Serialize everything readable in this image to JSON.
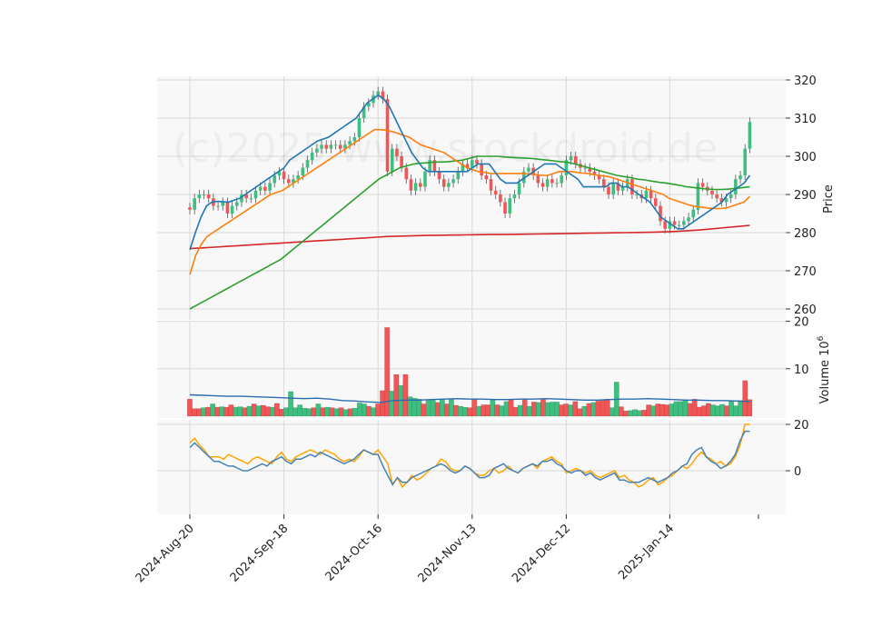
{
  "watermark": "(c)2025 www.stockdroid.de",
  "colors": {
    "up": "#3fbf7f",
    "down": "#f25555",
    "panel_bg": "#f8f8f8",
    "grid": "#d9d9d9",
    "ma_short": "#1f77b4",
    "ma_mid": "#ff7f0e",
    "ma_long": "#2ca02c",
    "ma_200": "#d62728",
    "vol_ma": "#2b6cb0",
    "osc_a": "#ffa500",
    "osc_b": "#4682b4"
  },
  "chart_data": [
    {
      "type": "candlestick",
      "panel": "price",
      "ylabel": "Price",
      "ylim": [
        257,
        320
      ],
      "yticks": [
        260,
        270,
        280,
        290,
        300,
        310,
        320
      ],
      "x_tick_labels": [
        "2024-Aug-20",
        "2024-Sep-18",
        "2024-Oct-16",
        "2024-Nov-13",
        "2024-Dec-12",
        "2025-Jan-14"
      ],
      "x_tick_index": [
        0,
        20,
        40,
        60,
        80,
        102
      ],
      "close": [
        286,
        289,
        290,
        290,
        289,
        287,
        287,
        288,
        285,
        287,
        288,
        290,
        289,
        289,
        291,
        292,
        291,
        293,
        295,
        296,
        294,
        293,
        294,
        295,
        297,
        299,
        301,
        302,
        303,
        302,
        303,
        303,
        302,
        303,
        304,
        305,
        310,
        313,
        314,
        316,
        317,
        315,
        296,
        302,
        300,
        297,
        294,
        291,
        293,
        292,
        296,
        299,
        296,
        294,
        292,
        293,
        294,
        296,
        298,
        297,
        299,
        298,
        295,
        294,
        291,
        290,
        288,
        285,
        289,
        290,
        293,
        296,
        297,
        295,
        293,
        292,
        294,
        293,
        293,
        295,
        299,
        300,
        298,
        297,
        297,
        296,
        295,
        294,
        292,
        290,
        293,
        291,
        292,
        294,
        290,
        290,
        289,
        291,
        289,
        287,
        283,
        281,
        283,
        282,
        282,
        283,
        284,
        286,
        293,
        292,
        291,
        290,
        289,
        288,
        289,
        290,
        294,
        295,
        302,
        309
      ],
      "ma_short_20": [
        275.5,
        280,
        284,
        287,
        288,
        288.2,
        288.1,
        288,
        288.5,
        289,
        290,
        291,
        292,
        293,
        294,
        295,
        296,
        297,
        299,
        300,
        301,
        302,
        303,
        304,
        304.5,
        305,
        306,
        307,
        308,
        309,
        310,
        312,
        314,
        315,
        316,
        315,
        313,
        310,
        307,
        304,
        301,
        299,
        297,
        296,
        296,
        296,
        296,
        296,
        296,
        296,
        296,
        297,
        298,
        298,
        298,
        296,
        294,
        293,
        293,
        293,
        294,
        295,
        296,
        297,
        298,
        298,
        298,
        297,
        296,
        295,
        294,
        292,
        292,
        292,
        292,
        292,
        293,
        293,
        292,
        292,
        291,
        290,
        289,
        288,
        286,
        284,
        283,
        282,
        281,
        281,
        282,
        283,
        284,
        285,
        286,
        287,
        288,
        290,
        291,
        292,
        293,
        295
      ],
      "ma_mid_50": [
        269,
        274,
        277,
        279,
        280,
        281,
        282,
        283,
        284,
        285,
        286,
        287,
        288,
        289,
        290,
        290.5,
        291,
        292,
        293,
        294,
        295,
        296,
        297,
        298,
        299,
        300,
        301,
        302,
        303,
        304,
        305,
        306,
        307,
        307,
        306.8,
        306.5,
        306,
        305.5,
        305,
        304,
        303,
        302.5,
        302,
        301.5,
        301,
        300,
        299,
        298,
        297,
        296.5,
        296,
        295.8,
        295.5,
        295.5,
        295.5,
        295.5,
        295.5,
        295.5,
        295.5,
        295.3,
        295.2,
        295,
        295,
        295.5,
        296,
        296,
        296,
        295.8,
        295.6,
        295.5,
        295.2,
        295,
        294.8,
        294.5,
        294,
        293.5,
        293,
        292.5,
        292,
        291.5,
        291,
        290.5,
        290,
        289,
        288.5,
        288,
        287.5,
        287,
        286.8,
        286.6,
        286.4,
        286.3,
        286.3,
        286.5,
        287,
        287.5,
        288,
        289.5
      ],
      "ma_long_100": [
        260,
        261,
        262,
        263,
        264,
        265,
        266,
        267,
        268,
        269,
        270,
        271,
        272,
        273,
        274.5,
        276,
        277.5,
        279,
        280.5,
        282,
        283.5,
        285,
        286.5,
        288,
        289.5,
        291,
        292.5,
        294,
        295,
        296,
        297,
        297.5,
        298,
        298.2,
        298.3,
        298.5,
        298.5,
        298.6,
        298.8,
        299,
        299.5,
        300,
        300,
        300,
        300,
        299.8,
        299.7,
        299.6,
        299.5,
        299.4,
        299.2,
        299,
        298.8,
        298.6,
        298.4,
        298,
        297.5,
        297,
        296.5,
        296,
        295.5,
        295,
        294.7,
        294.4,
        294,
        293.8,
        293.5,
        293.2,
        293,
        292.7,
        292.4,
        292,
        291.8,
        291.6,
        291.4,
        291.3,
        291.3,
        291.4,
        291.6,
        291.8,
        292
      ],
      "ma_200": [
        275.8,
        276,
        276.2,
        276.4,
        276.6,
        276.8,
        277,
        277.2,
        277.4,
        277.6,
        277.8,
        278,
        278.2,
        278.4,
        278.6,
        278.8,
        279,
        279.1,
        279.2,
        279.25,
        279.3,
        279.35,
        279.4,
        279.45,
        279.5,
        279.5,
        279.55,
        279.6,
        279.65,
        279.7,
        279.75,
        279.8,
        279.85,
        279.9,
        279.95,
        280,
        280.05,
        280.1,
        280.2,
        280.3,
        280.5,
        280.7,
        281,
        281.3,
        281.6,
        281.9
      ]
    },
    {
      "type": "bar",
      "panel": "volume",
      "ylabel": "Volume  10^6",
      "ylim": [
        0,
        20
      ],
      "yticks": [
        10,
        20
      ],
      "values": [
        3.6,
        1.6,
        1.6,
        1.8,
        1.9,
        2.6,
        1.9,
        2,
        1.9,
        2.4,
        1.9,
        2,
        1.8,
        2.1,
        2.6,
        2.2,
        2.3,
        2,
        1.9,
        2.7,
        1.5,
        1.8,
        5.2,
        1.8,
        2.4,
        1.7,
        1.6,
        1.8,
        2.6,
        1.8,
        1.9,
        1.8,
        1.6,
        1.8,
        1.4,
        1.6,
        1.7,
        2.8,
        2.6,
        2.1,
        1.8,
        2.6,
        5.4,
        18.7,
        5.3,
        8.8,
        6.5,
        8.8,
        4.1,
        3.8,
        3.6,
        2.6,
        3.3,
        3.6,
        2.9,
        3.5,
        2.6,
        3.5,
        2.3,
        2.1,
        1.9,
        1.8,
        3.6,
        2.1,
        2.4,
        2.4,
        3.6,
        2.4,
        2.2,
        3.1,
        3.6,
        1.9,
        2.3,
        3.5,
        2.1,
        3,
        2.9,
        3.5,
        2.9,
        3,
        3,
        2.4,
        2.6,
        2.4,
        3.1,
        1.6,
        2.1,
        2.7,
        2.9,
        3.2,
        3.3,
        3.6,
        1.8,
        7.2,
        2,
        1.1,
        1.2,
        1.4,
        1.2,
        1.3,
        2.4,
        2.2,
        2.6,
        2.5,
        2.4,
        2.6,
        3.1,
        3.1,
        3.3,
        2.7,
        3.6,
        1.9,
        2.2,
        2.7,
        2.4,
        2.2,
        2.5,
        2.2,
        3.2,
        2.2,
        3.3,
        7.5,
        3.5
      ],
      "up_flags": [
        0,
        0,
        0,
        1,
        0,
        1,
        0,
        1,
        0,
        0,
        1,
        1,
        0,
        1,
        0,
        1,
        0,
        0,
        1,
        0,
        0,
        1,
        1,
        1,
        1,
        1,
        1,
        0,
        1,
        0,
        1,
        0,
        1,
        0,
        1,
        0,
        1,
        1,
        1,
        0,
        1,
        0,
        0,
        0,
        1,
        0,
        1,
        0,
        1,
        1,
        1,
        0,
        1,
        1,
        0,
        1,
        0,
        1,
        0,
        1,
        1,
        0,
        0,
        1,
        0,
        0,
        1,
        0,
        1,
        1,
        0,
        0,
        1,
        0,
        1,
        0,
        1,
        0,
        1,
        1,
        1,
        0,
        0,
        1,
        0,
        0,
        1,
        0,
        1,
        0,
        0,
        0,
        1,
        1,
        0,
        0,
        1,
        1,
        1,
        0,
        0,
        1,
        0,
        0,
        0,
        1,
        1,
        1,
        1,
        0,
        0,
        0,
        0,
        0,
        1,
        1,
        1,
        0,
        1,
        1,
        1
      ],
      "avg": [
        4.5,
        4.4,
        4.3,
        4.2,
        4.2,
        4.1,
        4,
        3.9,
        3.8,
        3.7,
        3.8,
        3.6,
        3.3,
        3.2,
        3,
        2.9,
        3.3,
        3.4,
        3.4,
        3.5,
        3.6,
        3.7,
        3.6,
        3.6,
        3.5,
        3.5,
        3.6,
        3.6,
        3.7,
        3.6,
        3.5,
        3.4,
        3.4,
        3.5,
        3.6,
        3.6,
        3.7,
        3.6,
        3.5,
        3.4,
        3.4,
        3.3,
        3.3,
        3.2,
        3.1
      ]
    },
    {
      "type": "line",
      "panel": "oscillator",
      "ylim": [
        -10,
        20
      ],
      "yticks": [
        0,
        20
      ],
      "series": [
        {
          "values": [
            12,
            14,
            11,
            9,
            6,
            6,
            6,
            5,
            7,
            6,
            5,
            4,
            3,
            5,
            6,
            5,
            4,
            3,
            6,
            8,
            5,
            4,
            6,
            7,
            8,
            9,
            8,
            7,
            9,
            8,
            7,
            5,
            4,
            5,
            4,
            6,
            9,
            8,
            7,
            9,
            6,
            3,
            -6,
            -3,
            -7,
            -5,
            -2,
            -4,
            -3,
            -1,
            1,
            2,
            5,
            4,
            1,
            0,
            0,
            2,
            1,
            -1,
            -2,
            -2,
            0,
            1,
            -1,
            0,
            2,
            0,
            -1,
            1,
            2,
            3,
            1,
            4,
            5,
            6,
            4,
            3,
            -1,
            0,
            1,
            0,
            -1,
            0,
            -2,
            -3,
            -2,
            -1,
            0,
            -3,
            -2,
            -4,
            -5,
            -7,
            -6,
            -4,
            -3,
            -6,
            -5,
            -3,
            -2,
            0,
            2,
            1,
            3,
            6,
            8,
            6,
            5,
            3,
            4,
            2,
            3,
            6,
            11,
            20,
            20
          ]
        },
        {
          "values": [
            10,
            12,
            10,
            8,
            6,
            4,
            4,
            3,
            2,
            2,
            1,
            0,
            0,
            1,
            2,
            3,
            2,
            4,
            5,
            6,
            4,
            3,
            5,
            5,
            6,
            7,
            6,
            8,
            7,
            6,
            5,
            4,
            3,
            4,
            5,
            7,
            9,
            8,
            7,
            7,
            2,
            -2,
            -6,
            -3,
            -5,
            -5,
            -3,
            -2,
            -1,
            0,
            1,
            2,
            3,
            2,
            0,
            -1,
            0,
            2,
            1,
            -1,
            -3,
            -3,
            -2,
            1,
            2,
            3,
            1,
            0,
            -1,
            1,
            2,
            3,
            2,
            4,
            4,
            5,
            3,
            2,
            0,
            -1,
            0,
            0,
            -2,
            -1,
            -3,
            -4,
            -3,
            -2,
            -1,
            -4,
            -4,
            -5,
            -5,
            -5,
            -4,
            -3,
            -4,
            -5,
            -4,
            -3,
            -1,
            0,
            2,
            3,
            7,
            9,
            10,
            6,
            4,
            3,
            1,
            2,
            4,
            7,
            13,
            17,
            17
          ]
        }
      ]
    }
  ]
}
